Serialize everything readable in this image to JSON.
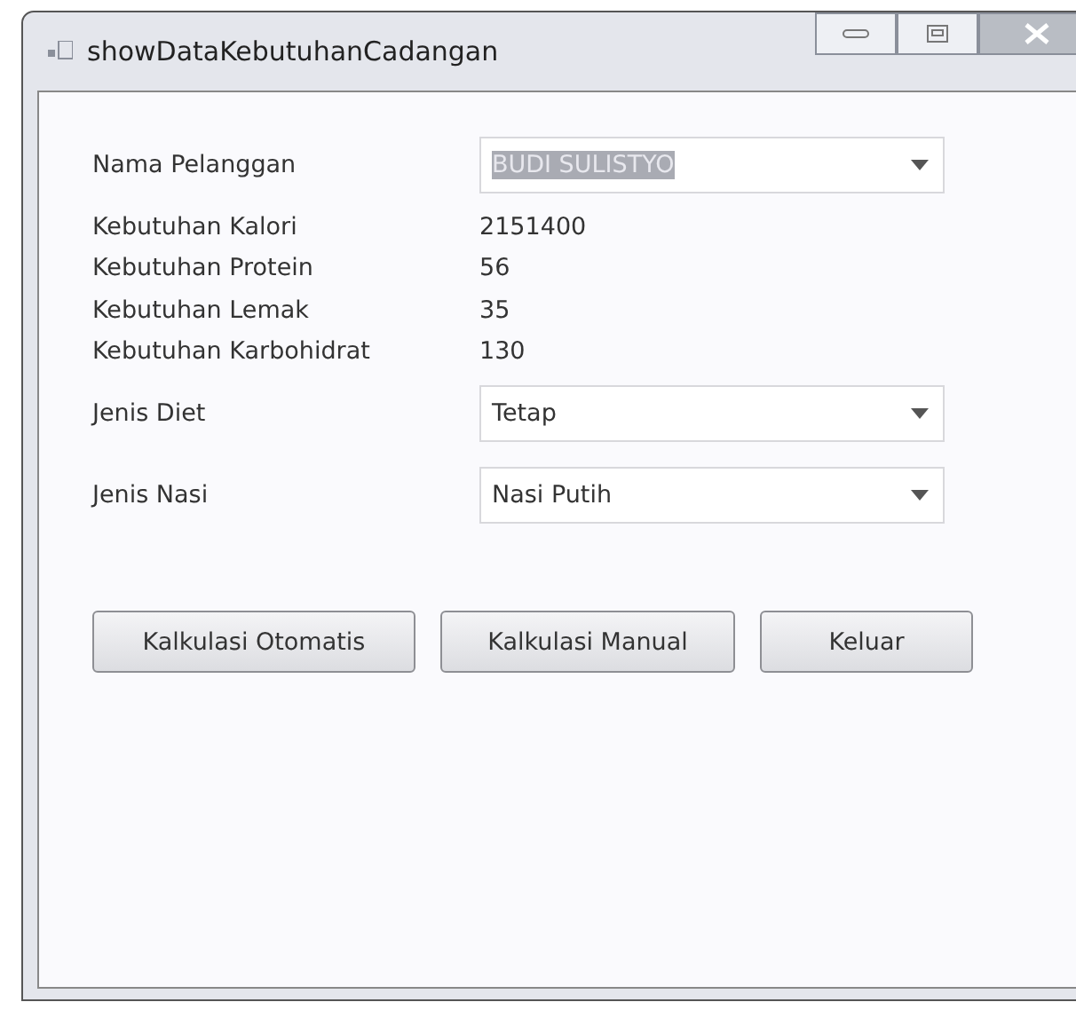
{
  "window": {
    "title": "showDataKebutuhanCadangan"
  },
  "fields": [
    {
      "kind": "combo",
      "label": "Nama Pelanggan",
      "value": "BUDI SULISTYO",
      "text_selected": true
    },
    {
      "kind": "text",
      "label": "Kebutuhan Kalori",
      "value": "2151400"
    },
    {
      "kind": "text",
      "label": "Kebutuhan Protein",
      "value": "56"
    },
    {
      "kind": "text",
      "label": "Kebutuhan Lemak",
      "value": "35"
    },
    {
      "kind": "text",
      "label": "Kebutuhan Karbohidrat",
      "value": "130"
    },
    {
      "kind": "combo",
      "label": "Jenis Diet",
      "value": "Tetap",
      "text_selected": false
    },
    {
      "kind": "combo",
      "label": "Jenis Nasi",
      "value": "Nasi Putih",
      "text_selected": false
    }
  ],
  "buttons": [
    "Kalkulasi Otomatis",
    "Kalkulasi Manual",
    "Keluar"
  ]
}
